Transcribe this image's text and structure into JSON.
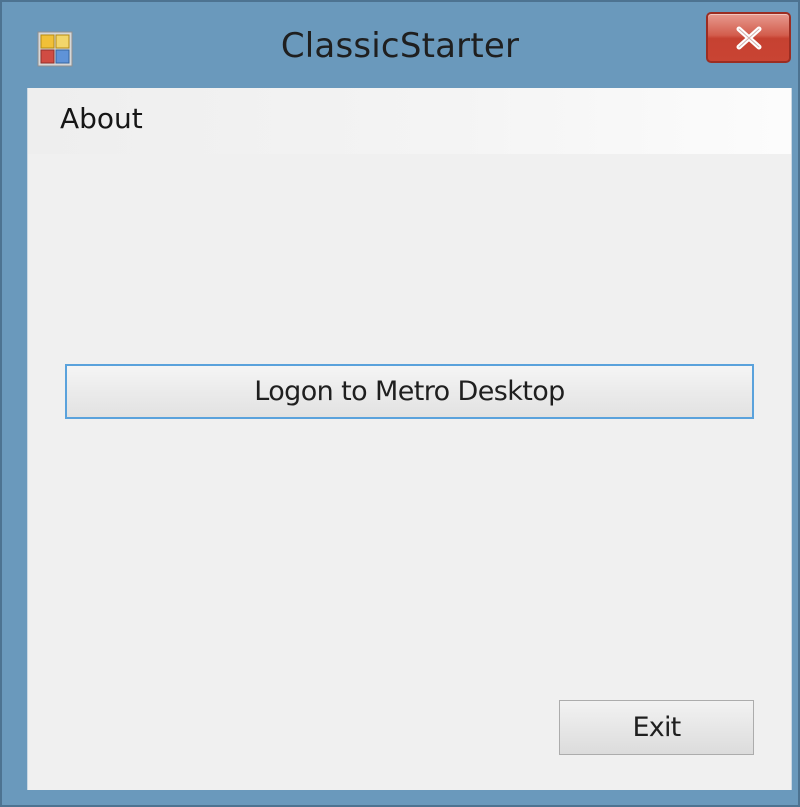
{
  "window": {
    "title": "ClassicStarter",
    "app_icon": "windows-form-icon",
    "close_icon": "close-icon",
    "frame_color": "#6a99bc",
    "close_button_color": "#c94433"
  },
  "menu": {
    "items": [
      {
        "label": "About"
      }
    ]
  },
  "buttons": {
    "logon_label": "Logon to Metro Desktop",
    "exit_label": "Exit",
    "focus_border_color": "#5aa2dc"
  }
}
